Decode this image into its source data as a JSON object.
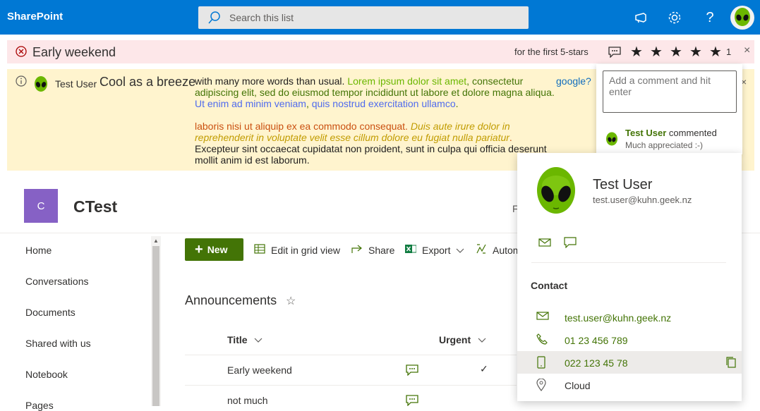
{
  "topbar": {
    "brand": "SharePoint",
    "search_placeholder": "Search this list"
  },
  "alert": {
    "title": "Early weekend",
    "rating_text": "for the first 5-stars",
    "stars": [
      "★",
      "★",
      "★",
      "★",
      "★"
    ],
    "count": "1",
    "close": "×"
  },
  "info": {
    "user": "Test User",
    "headline": "Cool as a breeze",
    "p1_a": "with many more words than usual. ",
    "p1_b": "Lorem ipsum dolor sit amet",
    "p1_c": ", consectetur adipiscing elit, sed do eiusmod tempor incididunt ut labore et dolore magna aliqua. ",
    "p1_d": "Ut enim ad minim veniam",
    "p1_e": ", ",
    "p1_f": "quis nostrud exercitation ullamco",
    "p1_g": ".",
    "p2_a": "laboris nisi ut aliquip ex ea commodo consequat. ",
    "p2_b": "Duis aute irure dolor in reprehenderit in voluptate velit esse cillum dolore eu fugiat nulla pariatur",
    "p2_c": ".",
    "p3": "Excepteur sint occaecat cupidatat non proident, sunt in culpa qui officia deserunt mollit anim id est laborum.",
    "link": "google?",
    "close": "×"
  },
  "site": {
    "logo_letter": "C",
    "name": "CTest",
    "follow_partial": "F"
  },
  "nav": [
    "Home",
    "Conversations",
    "Documents",
    "Shared with us",
    "Notebook",
    "Pages"
  ],
  "commands": {
    "new": "New",
    "edit_grid": "Edit in grid view",
    "share": "Share",
    "export": "Export",
    "automate": "Autom"
  },
  "list": {
    "title": "Announcements",
    "col_title": "Title",
    "col_urgent": "Urgent",
    "rows": [
      "Early weekend",
      "not much"
    ],
    "checkmark": "✓"
  },
  "comment_panel": {
    "placeholder": "Add a comment and hit enter",
    "user": "Test User",
    "action": " commented",
    "text": "Much appreciated :-)"
  },
  "card": {
    "name": "Test User",
    "email": "test.user@kuhn.geek.nz",
    "contact_label": "Contact",
    "email_line": "test.user@kuhn.geek.nz",
    "phone": "01 23 456 789",
    "mobile": "022 123 45 78",
    "location": "Cloud"
  },
  "colors": {
    "brand": "#0078d4",
    "accent_green": "#437406",
    "alert_bg": "#fde7e9",
    "info_bg": "#fff4ce",
    "site_logo": "#8661c5"
  }
}
